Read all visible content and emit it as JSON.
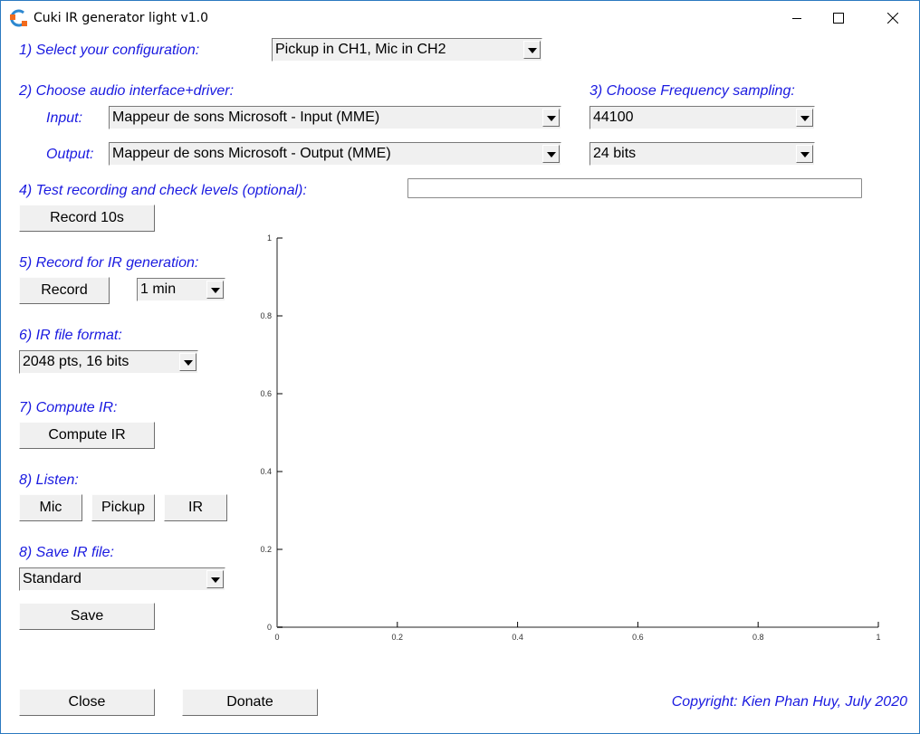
{
  "window": {
    "title": "Cuki IR generator light v1.0",
    "controls": [
      "minimize",
      "maximize",
      "close"
    ]
  },
  "step1": {
    "label": "1) Select your configuration:",
    "value": "Pickup in CH1, Mic in CH2"
  },
  "step2": {
    "label": "2) Choose audio interface+driver:",
    "input_label": "Input:",
    "input_value": "Mappeur de sons Microsoft - Input (MME)",
    "output_label": "Output:",
    "output_value": "Mappeur de sons Microsoft - Output (MME)"
  },
  "step3": {
    "label": "3) Choose Frequency sampling:",
    "rate_value": "44100",
    "bits_value": "24 bits"
  },
  "step4": {
    "label": "4) Test recording and check levels (optional):",
    "button": "Record 10s",
    "level_percent": 0
  },
  "step5": {
    "label": "5) Record for IR generation:",
    "button": "Record",
    "duration_value": "1 min"
  },
  "step6": {
    "label": "6) IR file format:",
    "value": "2048 pts, 16 bits"
  },
  "step7": {
    "label": "7) Compute IR:",
    "button": "Compute IR"
  },
  "step8_listen": {
    "label": "8) Listen:",
    "buttons": [
      "Mic",
      "Pickup",
      "IR"
    ]
  },
  "step8_save": {
    "label": "8) Save IR file:",
    "value": "Standard",
    "button": "Save"
  },
  "footer": {
    "close": "Close",
    "donate": "Donate",
    "copyright": "Copyright: Kien Phan Huy, July 2020"
  },
  "chart_data": {
    "type": "line",
    "title": "",
    "xlabel": "",
    "ylabel": "",
    "series": [],
    "xlim": [
      0,
      1
    ],
    "ylim": [
      0,
      1
    ],
    "x_ticks": [
      "0",
      "0.2",
      "0.4",
      "0.6",
      "0.8",
      "1"
    ],
    "y_ticks": [
      "0",
      "0.2",
      "0.4",
      "0.6",
      "0.8",
      "1"
    ],
    "grid": false
  }
}
